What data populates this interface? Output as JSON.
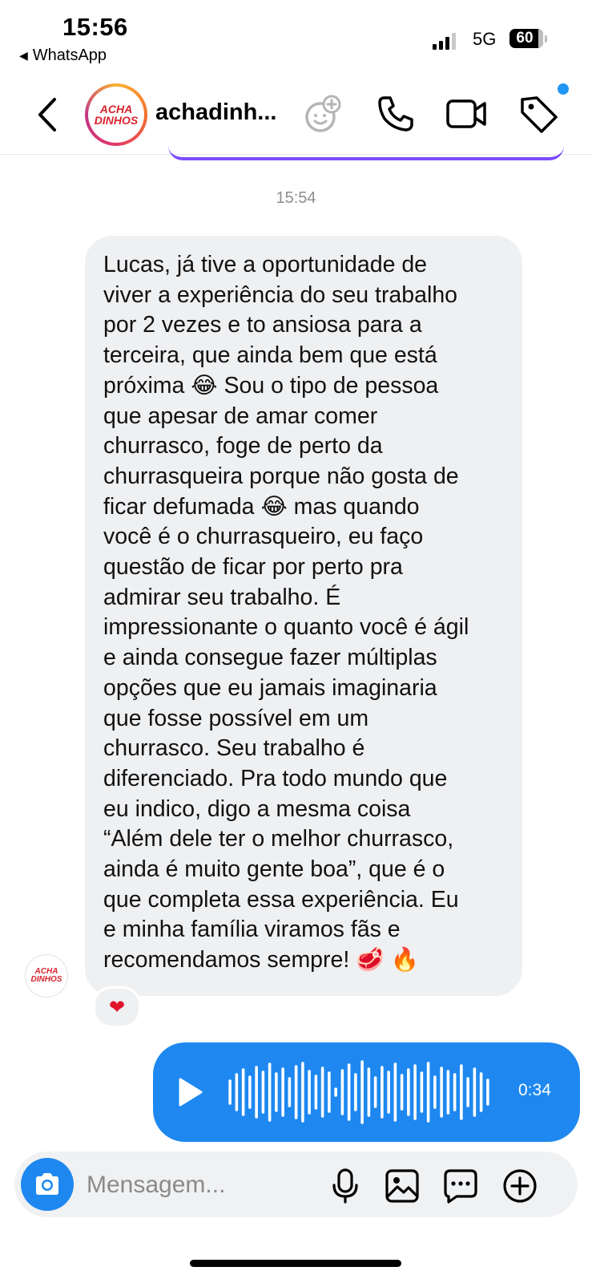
{
  "status_bar": {
    "time": "15:56",
    "back_app": "WhatsApp",
    "network": "5G",
    "battery": "60"
  },
  "header": {
    "contact_name": "achadinh...",
    "avatar_logo": [
      "ACHA",
      "DINHOS"
    ],
    "icons": [
      "back-chevron-icon",
      "add-emoji-icon",
      "phone-icon",
      "video-camera-icon",
      "tag-icon"
    ],
    "notification_dot_color": "#2196f3"
  },
  "chat": {
    "timestamp": "15:54",
    "received_message": "Lucas, já tive a oportunidade de\nviver a experiência do seu trabalho\npor 2 vezes e to ansiosa para a\nterceira, que ainda bem que está\npróxima 😂 Sou o tipo de pessoa\nque apesar de amar comer\nchurrasco, foge de perto da\nchurrasqueira porque não gosta de\nficar defumada 😂 mas quando\nvocê é o churrasqueiro, eu faço\nquestão de ficar por perto pra\nadmirar seu trabalho. É\nimpressionante o quanto você é ágil\ne ainda consegue fazer múltiplas\nopções que eu jamais imaginaria\nque fosse possível em um\nchurrasco. Seu trabalho é\ndiferenciado. Pra todo mundo que\neu indico, digo a mesma coisa\n“Além dele ter o melhor churrasco,\nainda é muito gente boa”, que é o\nque completa essa experiência. Eu\ne minha família viramos fãs e\nrecomendamos sempre! 🥩 🔥",
    "reaction": "❤",
    "voice_message": {
      "duration": "0:34",
      "bubble_color": "#1e88f0"
    }
  },
  "composer": {
    "placeholder": "Mensagem...",
    "icons": [
      "camera-icon",
      "microphone-icon",
      "gallery-icon",
      "sticker-icon",
      "add-icon"
    ]
  }
}
